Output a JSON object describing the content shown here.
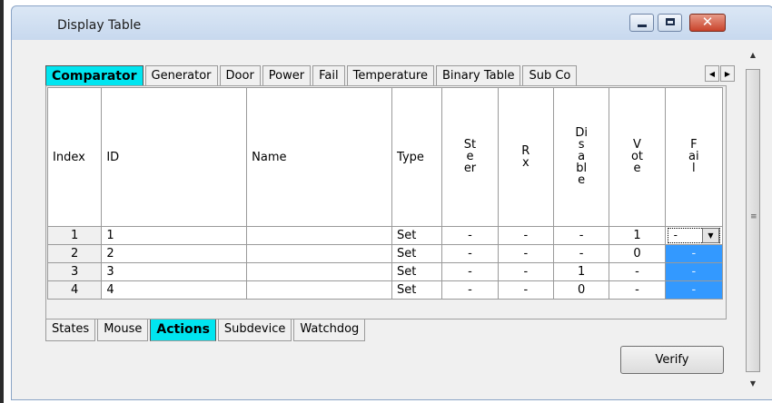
{
  "window": {
    "title": "Display Table"
  },
  "top_tabs": [
    "Comparator",
    "Generator",
    "Door",
    "Power",
    "Fail",
    "Temperature",
    "Binary Table",
    "Sub Co"
  ],
  "active_top_tab": "Comparator",
  "bottom_tabs": [
    "States",
    "Mouse",
    "Actions",
    "Subdevice",
    "Watchdog"
  ],
  "active_bottom_tab": "Actions",
  "table": {
    "headers": [
      "Index",
      "ID",
      "Name",
      "Type",
      "Steer",
      "Rx",
      "Disable",
      "Vote",
      "Fail"
    ],
    "rows": [
      {
        "index": "1",
        "id": "1",
        "name": "",
        "type": "Set",
        "steer": "-",
        "rx": "-",
        "disable": "-",
        "vote": "1",
        "fail": "-"
      },
      {
        "index": "2",
        "id": "2",
        "name": "",
        "type": "Set",
        "steer": "-",
        "rx": "-",
        "disable": "-",
        "vote": "0",
        "fail": "-"
      },
      {
        "index": "3",
        "id": "3",
        "name": "",
        "type": "Set",
        "steer": "-",
        "rx": "-",
        "disable": "1",
        "vote": "-",
        "fail": "-"
      },
      {
        "index": "4",
        "id": "4",
        "name": "",
        "type": "Set",
        "steer": "-",
        "rx": "-",
        "disable": "0",
        "vote": "-",
        "fail": "-"
      }
    ]
  },
  "buttons": {
    "verify": "Verify"
  },
  "icons": {
    "minimize": "minimize-icon",
    "maximize": "maximize-icon",
    "close": "close-icon",
    "close_glyph": "✕"
  },
  "colors": {
    "active_tab": "#00e5f0",
    "selected_cell": "#3399ff",
    "close_button": "#c9432b"
  }
}
